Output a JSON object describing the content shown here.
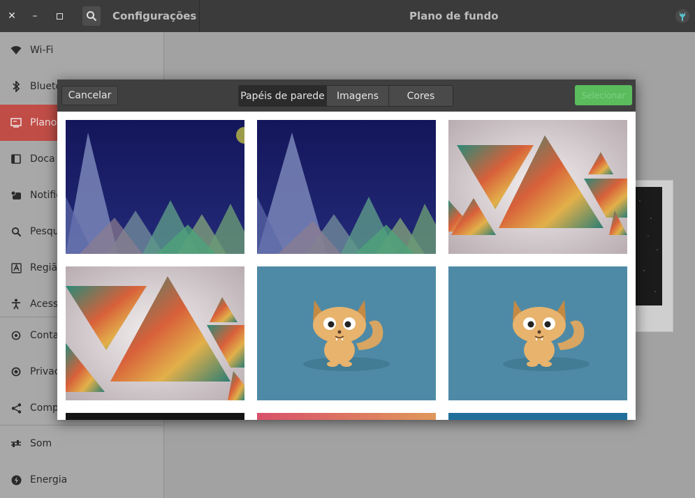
{
  "titlebar": {
    "app_title": "Configurações",
    "center_title": "Plano de fundo",
    "close_glyph": "✕",
    "minimize_glyph": "–",
    "maximize_glyph": "▫"
  },
  "sidebar": {
    "items": [
      {
        "label": "Wi-Fi",
        "icon": "wifi-icon"
      },
      {
        "label": "Bluetooth",
        "icon": "bluetooth-icon"
      },
      {
        "label": "Plano de fundo",
        "icon": "background-icon"
      },
      {
        "label": "Doca",
        "icon": "dock-icon"
      },
      {
        "label": "Notificações",
        "icon": "notifications-icon"
      },
      {
        "label": "Pesquisar",
        "icon": "search-icon"
      },
      {
        "label": "Região e idioma",
        "icon": "region-icon"
      },
      {
        "label": "Acessibilidade",
        "icon": "accessibility-icon"
      },
      {
        "label": "Contas online",
        "icon": "accounts-icon"
      },
      {
        "label": "Privacidade",
        "icon": "privacy-icon"
      },
      {
        "label": "Compartilhar",
        "icon": "share-icon"
      },
      {
        "label": "Som",
        "icon": "sound-icon"
      },
      {
        "label": "Energia",
        "icon": "power-icon"
      }
    ]
  },
  "dialog": {
    "cancel_label": "Cancelar",
    "select_label": "Selecionar",
    "tabs": [
      "Papéis de parede",
      "Imagens",
      "Cores"
    ]
  },
  "colors": {
    "accent_active": "#c14d47",
    "select_button": "#5bbc5e"
  }
}
